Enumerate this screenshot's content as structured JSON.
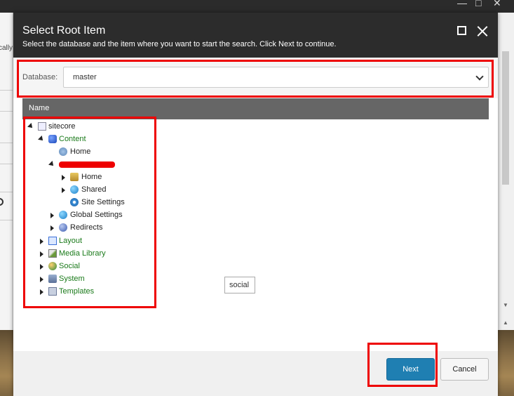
{
  "background": {
    "left_fragment": "cally"
  },
  "dialog": {
    "title": "Select Root Item",
    "subtitle": "Select the database and the item where you want to start the search. Click Next to continue.",
    "maximize_icon": "maximize-icon",
    "close_icon": "close-icon"
  },
  "database": {
    "label": "Database:",
    "selected": "master"
  },
  "tree": {
    "column_header": "Name",
    "nodes": [
      {
        "label": "sitecore",
        "icon": "document-icon",
        "state": "expanded"
      },
      {
        "label": "Content",
        "icon": "content-icon",
        "state": "expanded"
      },
      {
        "label": "Home",
        "icon": "home-icon",
        "state": "leaf"
      },
      {
        "label": "",
        "icon": "",
        "state": "expanded",
        "redacted": true
      },
      {
        "label": "Home",
        "icon": "home-icon",
        "state": "collapsed"
      },
      {
        "label": "Shared",
        "icon": "globe-icon",
        "state": "collapsed"
      },
      {
        "label": "Site Settings",
        "icon": "settings-icon",
        "state": "leaf"
      },
      {
        "label": "Global Settings",
        "icon": "globe-icon",
        "state": "collapsed"
      },
      {
        "label": "Redirects",
        "icon": "redirect-icon",
        "state": "collapsed"
      },
      {
        "label": "Layout",
        "icon": "layout-icon",
        "state": "collapsed"
      },
      {
        "label": "Media Library",
        "icon": "media-icon",
        "state": "collapsed"
      },
      {
        "label": "Social",
        "icon": "social-icon",
        "state": "collapsed"
      },
      {
        "label": "System",
        "icon": "system-icon",
        "state": "collapsed"
      },
      {
        "label": "Templates",
        "icon": "templates-icon",
        "state": "collapsed"
      }
    ]
  },
  "tooltip": "social",
  "footer": {
    "next_label": "Next",
    "cancel_label": "Cancel"
  },
  "colors": {
    "header_bg": "#2c2c2c",
    "primary_button": "#1f7fb2",
    "annotation": "#e00000",
    "tree_label_green": "#1a7a1a"
  }
}
